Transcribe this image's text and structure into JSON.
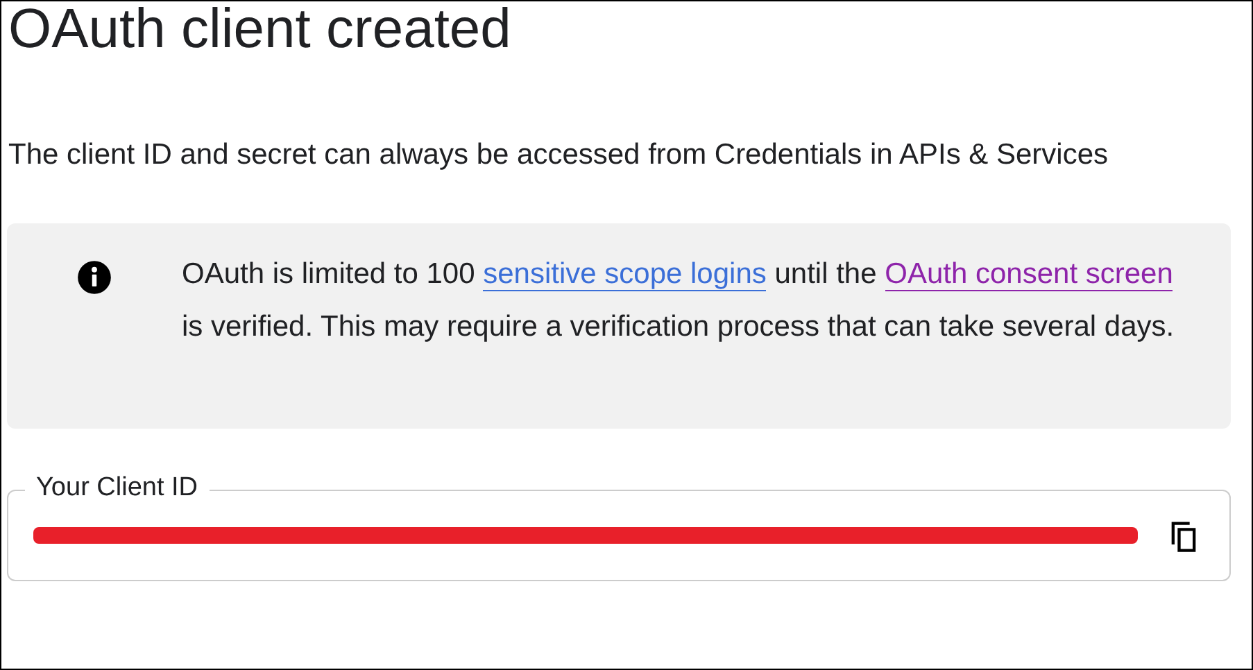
{
  "title": "OAuth client created",
  "description": "The client ID and secret can always be accessed from Credentials in APIs & Services",
  "notice": {
    "parts": [
      {
        "kind": "text",
        "text": "OAuth is limited to 100 "
      },
      {
        "kind": "link",
        "text": "sensitive scope logins",
        "visited": false
      },
      {
        "kind": "text",
        "text": " until the "
      },
      {
        "kind": "link",
        "text": "OAuth consent screen",
        "visited": true
      },
      {
        "kind": "text",
        "text": " is verified. This may require a verification process that can take several days."
      }
    ]
  },
  "client_id_field": {
    "label": "Your Client ID",
    "redacted": true
  }
}
